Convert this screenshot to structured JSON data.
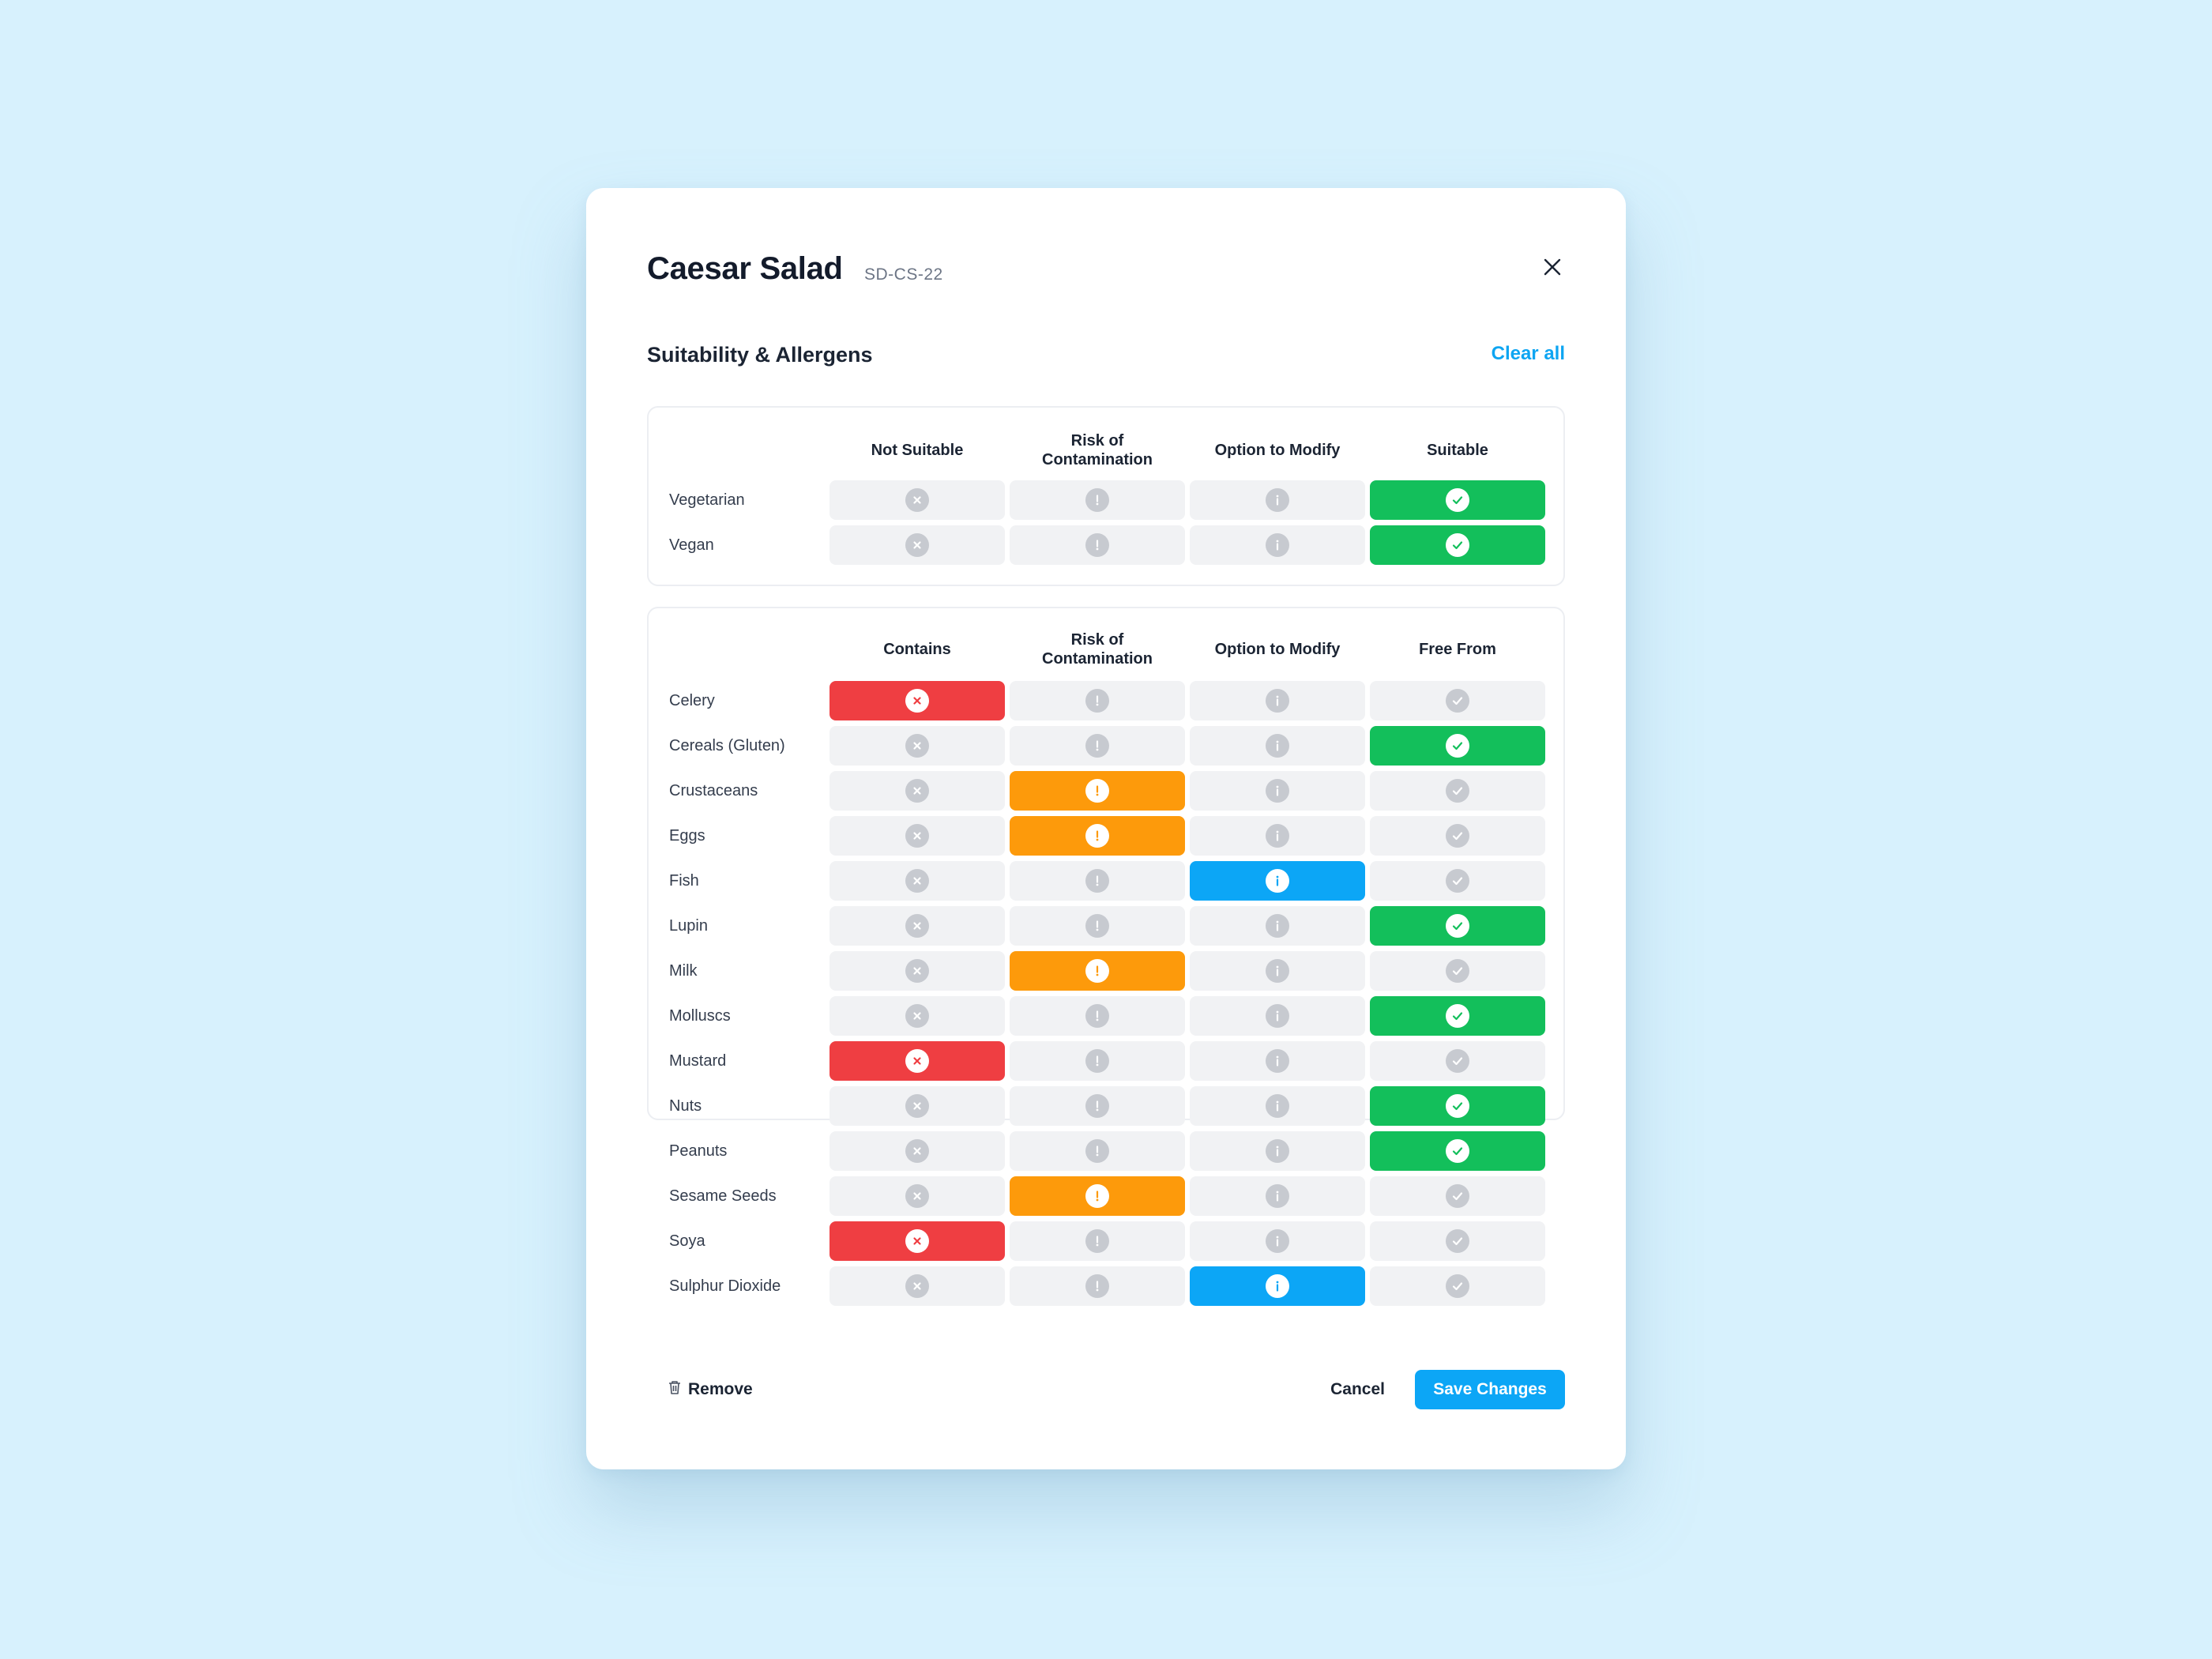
{
  "dialog": {
    "title": "Caesar Salad",
    "code": "SD-CS-22",
    "section_title": "Suitability & Allergens",
    "clear_all": "Clear all"
  },
  "colors": {
    "red": "#ef3e42",
    "orange": "#fd9a0b",
    "blue": "#0ca6f6",
    "green": "#13bf5b",
    "inactive": "#f1f2f4"
  },
  "suitability": {
    "columns": [
      "Not Suitable",
      "Risk of\nContamination",
      "Option to Modify",
      "Suitable"
    ],
    "column_icons": [
      "x-icon",
      "exclamation-icon",
      "info-icon",
      "check-icon"
    ],
    "rows": [
      {
        "label": "Vegetarian",
        "selected": 3
      },
      {
        "label": "Vegan",
        "selected": 3
      }
    ]
  },
  "allergens": {
    "columns": [
      "Contains",
      "Risk of\nContamination",
      "Option to Modify",
      "Free From"
    ],
    "column_icons": [
      "x-icon",
      "exclamation-icon",
      "info-icon",
      "check-icon"
    ],
    "rows": [
      {
        "label": "Celery",
        "selected": 0
      },
      {
        "label": "Cereals (Gluten)",
        "selected": 3
      },
      {
        "label": "Crustaceans",
        "selected": 1
      },
      {
        "label": "Eggs",
        "selected": 1
      },
      {
        "label": "Fish",
        "selected": 2
      },
      {
        "label": "Lupin",
        "selected": 3
      },
      {
        "label": "Milk",
        "selected": 1
      },
      {
        "label": "Molluscs",
        "selected": 3
      },
      {
        "label": "Mustard",
        "selected": 0
      },
      {
        "label": "Nuts",
        "selected": 3
      },
      {
        "label": "Peanuts",
        "selected": 3
      },
      {
        "label": "Sesame Seeds",
        "selected": 1
      },
      {
        "label": "Soya",
        "selected": 0
      },
      {
        "label": "Sulphur Dioxide",
        "selected": 2
      }
    ]
  },
  "footer": {
    "remove_label": "Remove",
    "cancel_label": "Cancel",
    "save_label": "Save Changes"
  }
}
